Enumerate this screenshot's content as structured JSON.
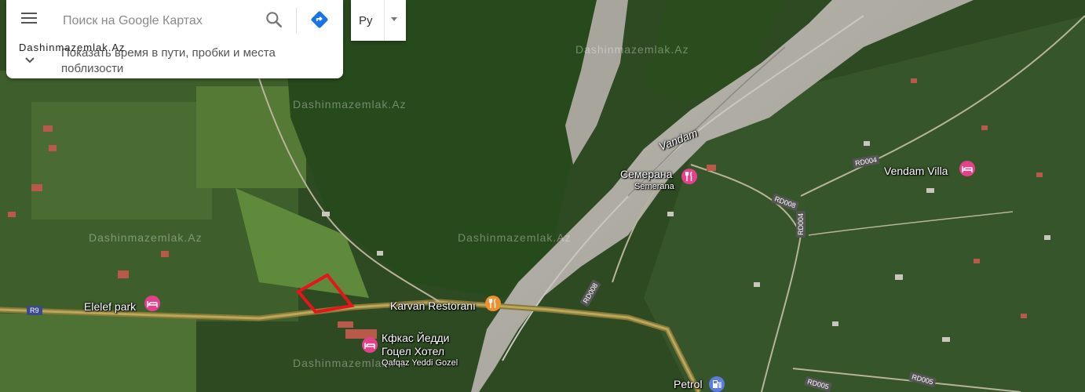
{
  "search": {
    "placeholder": "Поиск на Google Картах",
    "hint": "Показать время в пути, пробки и места поблизости"
  },
  "layer_selector": {
    "label": "Ру"
  },
  "watermark": "Dashinmazemlak.Az",
  "map_labels": {
    "river": "Vandam",
    "semerana_ru": "Семерана",
    "semerana_en": "Semerana",
    "vendam_villa": "Vendam Villa",
    "elelef_park": "Elelef park",
    "karvan": "Karvan Restoranı",
    "hotel_ru_line1": "Кфкас Йедди",
    "hotel_ru_line2": "Гоцел Хотел",
    "hotel_en": "Qafqaz Yeddi Gozel",
    "petrol": "Petrol"
  },
  "road_tags": {
    "r9": "R9",
    "rd004_a": "RD004",
    "rd004_b": "RD004",
    "rd008_a": "RD008",
    "rd008_b": "RD008",
    "rd005_a": "RD005",
    "rd005_b": "RD005"
  },
  "icons": {
    "menu": "hamburger-menu-icon",
    "search": "search-icon",
    "directions": "directions-icon",
    "chevron": "chevron-down-icon",
    "hotel": "hotel-bed-icon",
    "restaurant": "restaurant-icon",
    "fuel": "fuel-icon"
  },
  "colors": {
    "poi_pink": "#e4418c",
    "poi_orange": "#f28e2b",
    "poi_blue": "#5b7ce0",
    "directions_blue": "#1a73e8",
    "plot_outline": "#e8141b"
  }
}
